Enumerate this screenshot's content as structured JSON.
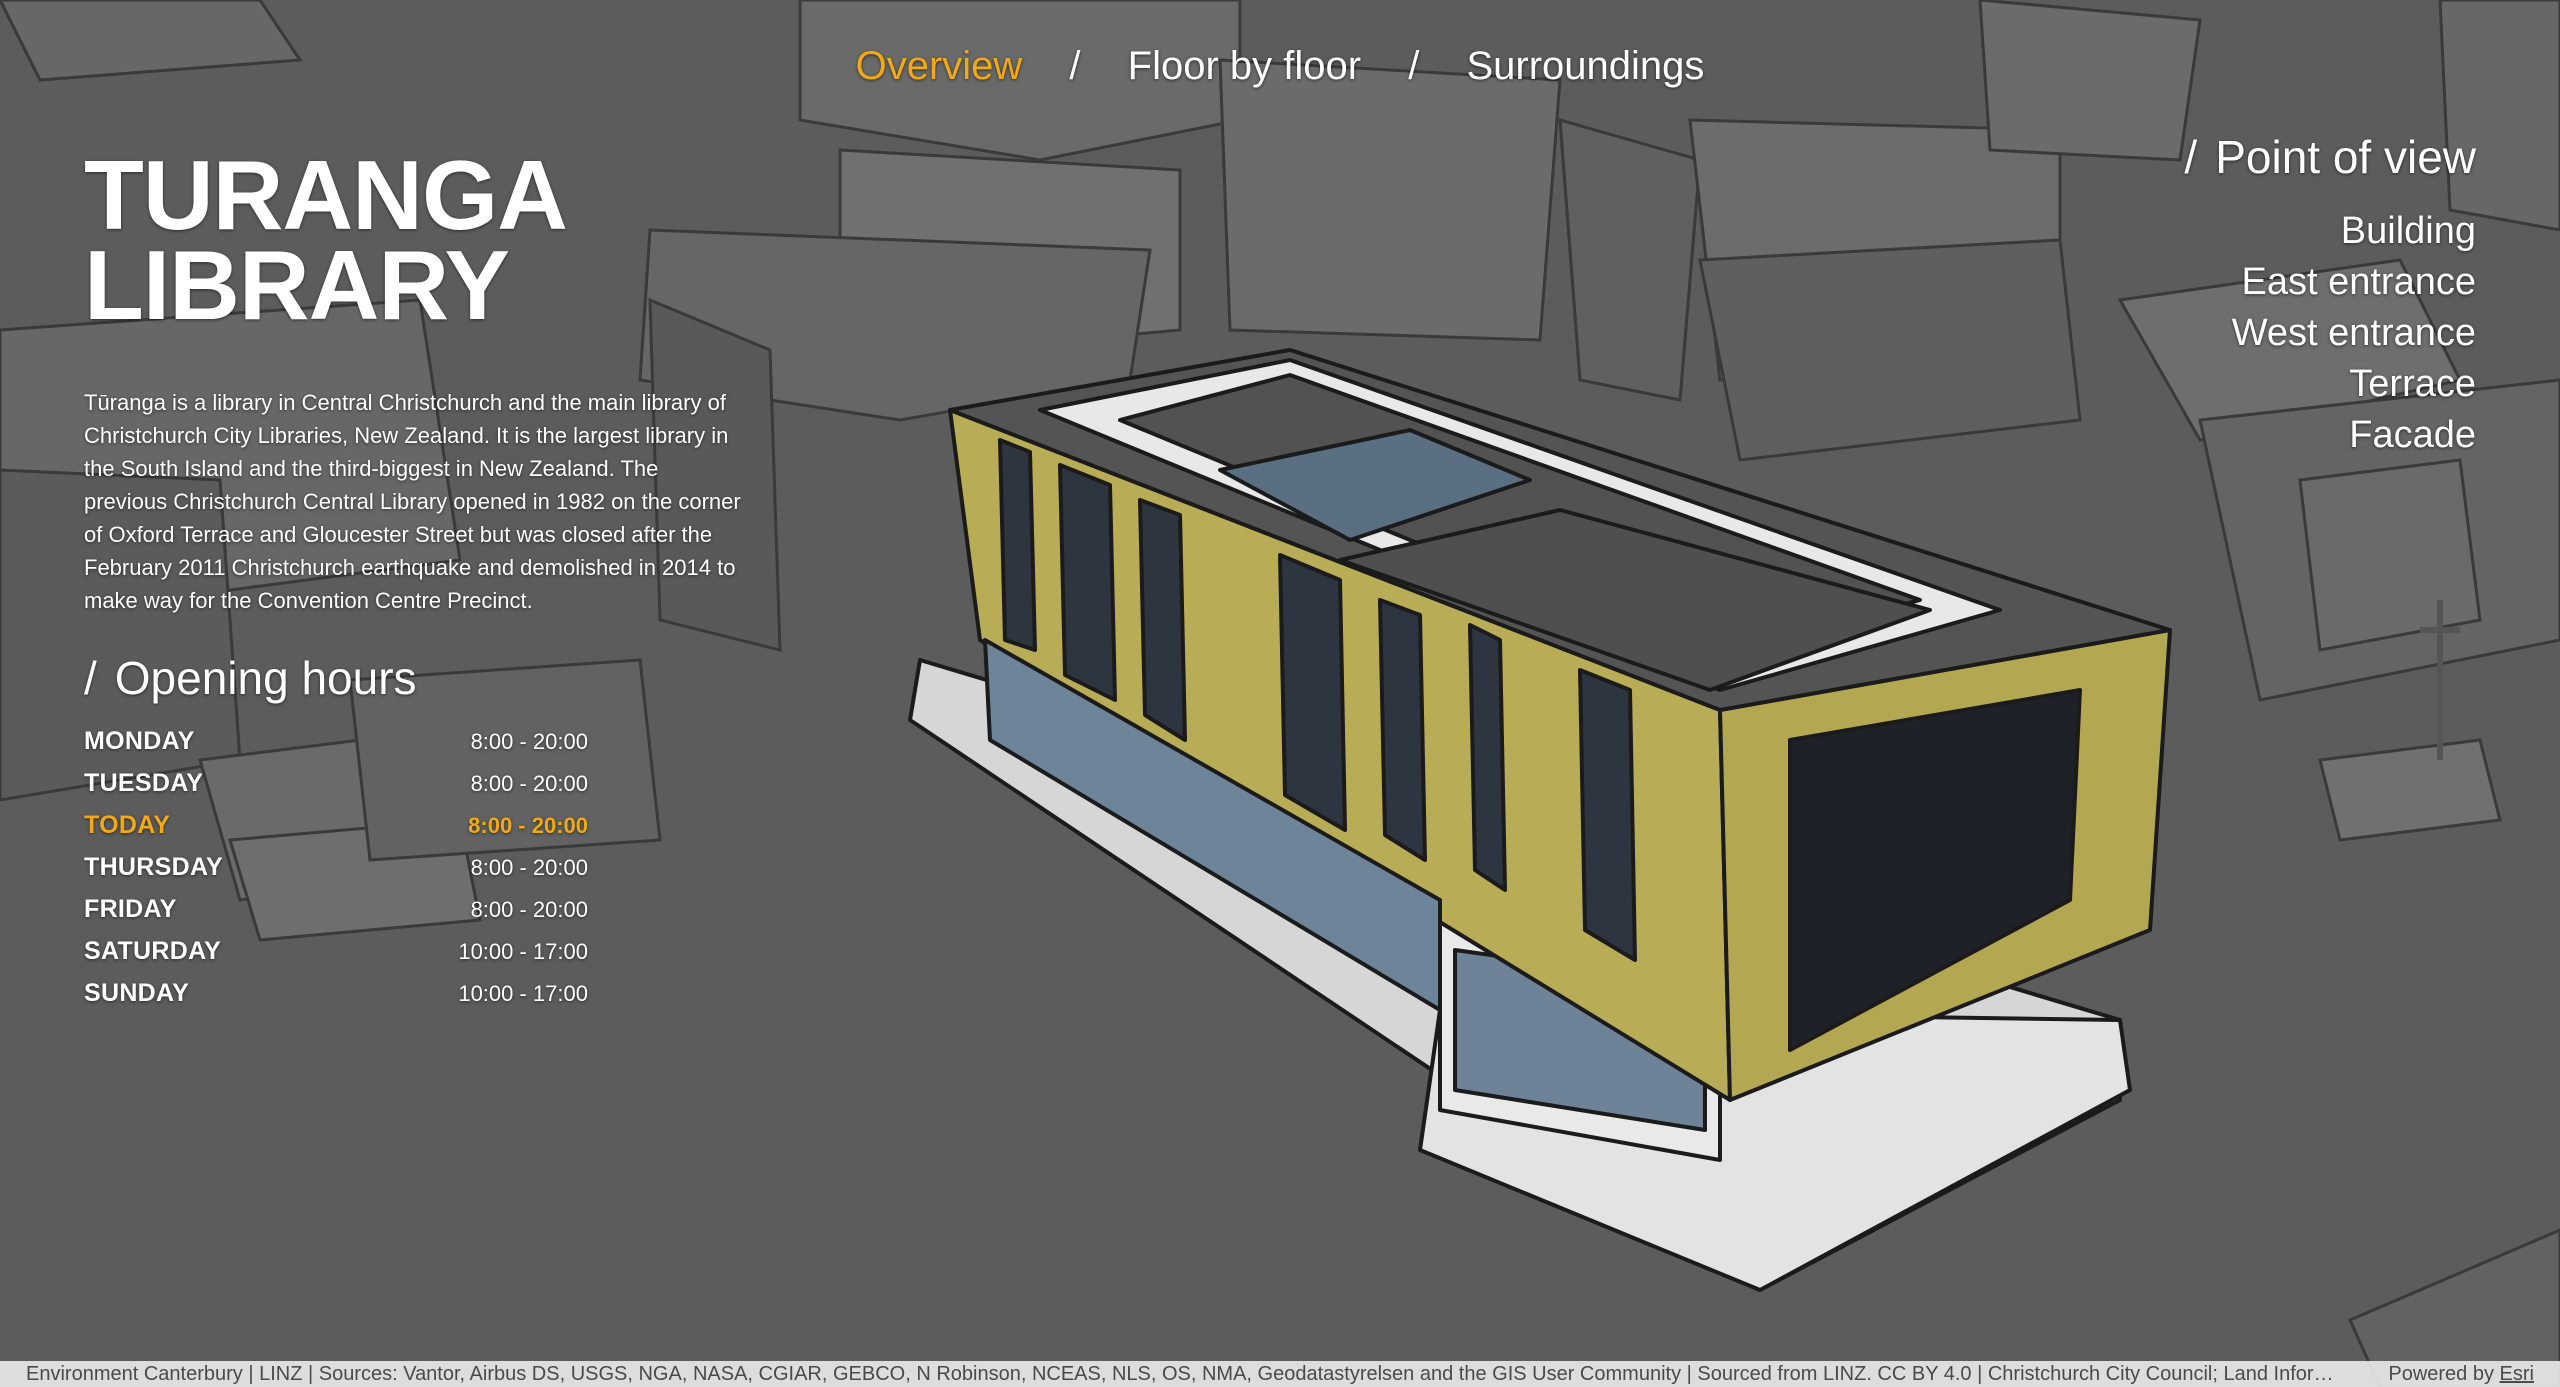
{
  "nav": {
    "tabs": [
      {
        "label": "Overview",
        "active": true
      },
      {
        "label": "Floor by floor",
        "active": false
      },
      {
        "label": "Surroundings",
        "active": false
      }
    ],
    "separator": "/"
  },
  "title": {
    "line1": "TURANGA",
    "line2": "LIBRARY"
  },
  "description": "Tūranga is a library in Central Christchurch and the main library of Christchurch City Libraries, New Zealand. It is the largest library in the South Island and the third-biggest in New Zealand. The previous Christchurch Central Library opened in 1982 on the corner of Oxford Terrace and Gloucester Street but was closed after the February 2011 Christchurch earthquake and demolished in 2014 to make way for the Convention Centre Precinct.",
  "opening_hours": {
    "slash": "/",
    "heading": "Opening hours",
    "rows": [
      {
        "day": "MONDAY",
        "time": "8:00 - 20:00"
      },
      {
        "day": "TUESDAY",
        "time": "8:00 - 20:00"
      },
      {
        "day": "TODAY",
        "time": "8:00 - 20:00",
        "highlight": true
      },
      {
        "day": "THURSDAY",
        "time": "8:00 - 20:00"
      },
      {
        "day": "FRIDAY",
        "time": "8:00 - 20:00"
      },
      {
        "day": "SATURDAY",
        "time": "10:00 - 17:00"
      },
      {
        "day": "SUNDAY",
        "time": "10:00 - 17:00"
      }
    ]
  },
  "point_of_view": {
    "slash": "/",
    "heading": "Point of view",
    "items": [
      "Building",
      "East entrance",
      "West entrance",
      "Terrace",
      "Facade"
    ]
  },
  "attribution": {
    "sources": "Environment Canterbury | LINZ | Sources: Vantor, Airbus DS, USGS, NGA, NASA, CGIAR, GEBCO, N Robinson, NCEAS, NLS, OS, NMA, Geodatastyrelsen and the GIS User Community | Sourced from LINZ. CC BY 4.0 | Christchurch City Council; Land Informatio...",
    "powered_by": "Powered by",
    "esri": "Esri"
  },
  "colors": {
    "accent": "#f3a814",
    "facade": "#b9ac57",
    "background": "#5b5b5b"
  },
  "icons": {
    "scene": "3d-building-scene"
  }
}
